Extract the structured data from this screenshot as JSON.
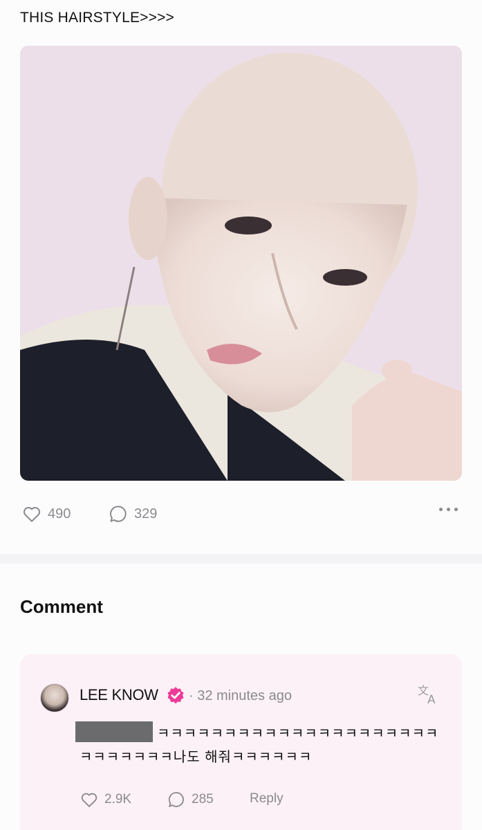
{
  "post": {
    "text": "THIS HAIRSTYLE>>>>",
    "image_alt": "selfie photo",
    "likes": "490",
    "comments": "329"
  },
  "section": {
    "title": "Comment"
  },
  "comment": {
    "author": "LEE KNOW",
    "time": "· 32 minutes ago",
    "line1": "ㅋㅋㅋㅋㅋㅋㅋㅋㅋㅋㅋㅋㅋㅋㅋㅋㅋㅋㅋㅋㅋ",
    "line2": "ㅋㅋㅋㅋㅋㅋㅋ나도 해줘ㅋㅋㅋㅋㅋㅋ",
    "likes": "2.9K",
    "replies": "285",
    "reply_label": "Reply"
  },
  "colors": {
    "accent": "#ec3c98",
    "muted": "#8a8a8e",
    "card_bg": "#fcf1f6"
  }
}
